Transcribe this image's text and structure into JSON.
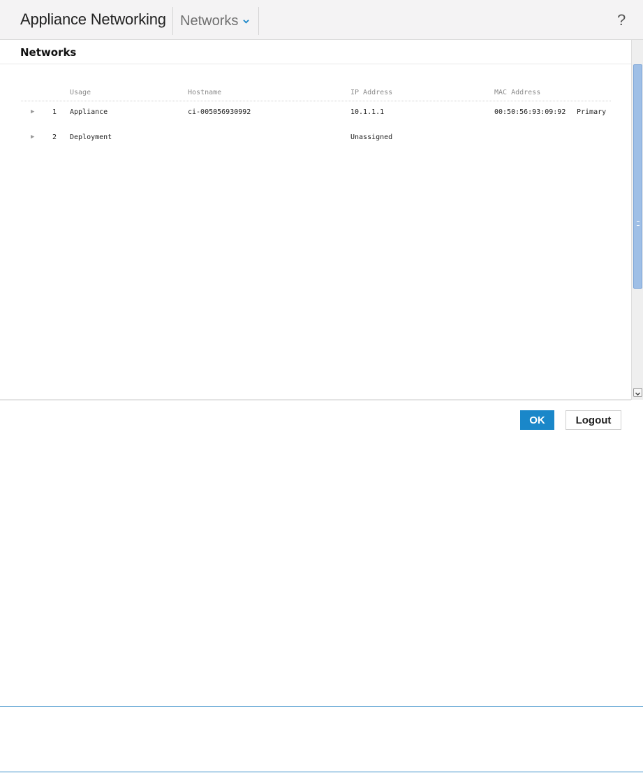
{
  "header": {
    "title": "Appliance Networking",
    "nav_label": "Networks",
    "help_label": "?"
  },
  "section": {
    "title": "Networks"
  },
  "table": {
    "columns": [
      "Usage",
      "Hostname",
      "IP Address",
      "MAC Address"
    ],
    "rows": [
      {
        "index": "1",
        "usage": "Appliance",
        "hostname": "ci-005056930992",
        "ip": "10.1.1.1",
        "mac": "00:50:56:93:09:92",
        "role": "Primary"
      },
      {
        "index": "2",
        "usage": "Deployment",
        "hostname": "",
        "ip": "Unassigned",
        "mac": "",
        "role": ""
      }
    ]
  },
  "buttons": {
    "ok_label": "OK",
    "logout_label": "Logout"
  },
  "colors": {
    "primary_button": "#1a87c9",
    "header_bg": "#f4f3f4",
    "accent_rule": "#3a8fc9"
  }
}
